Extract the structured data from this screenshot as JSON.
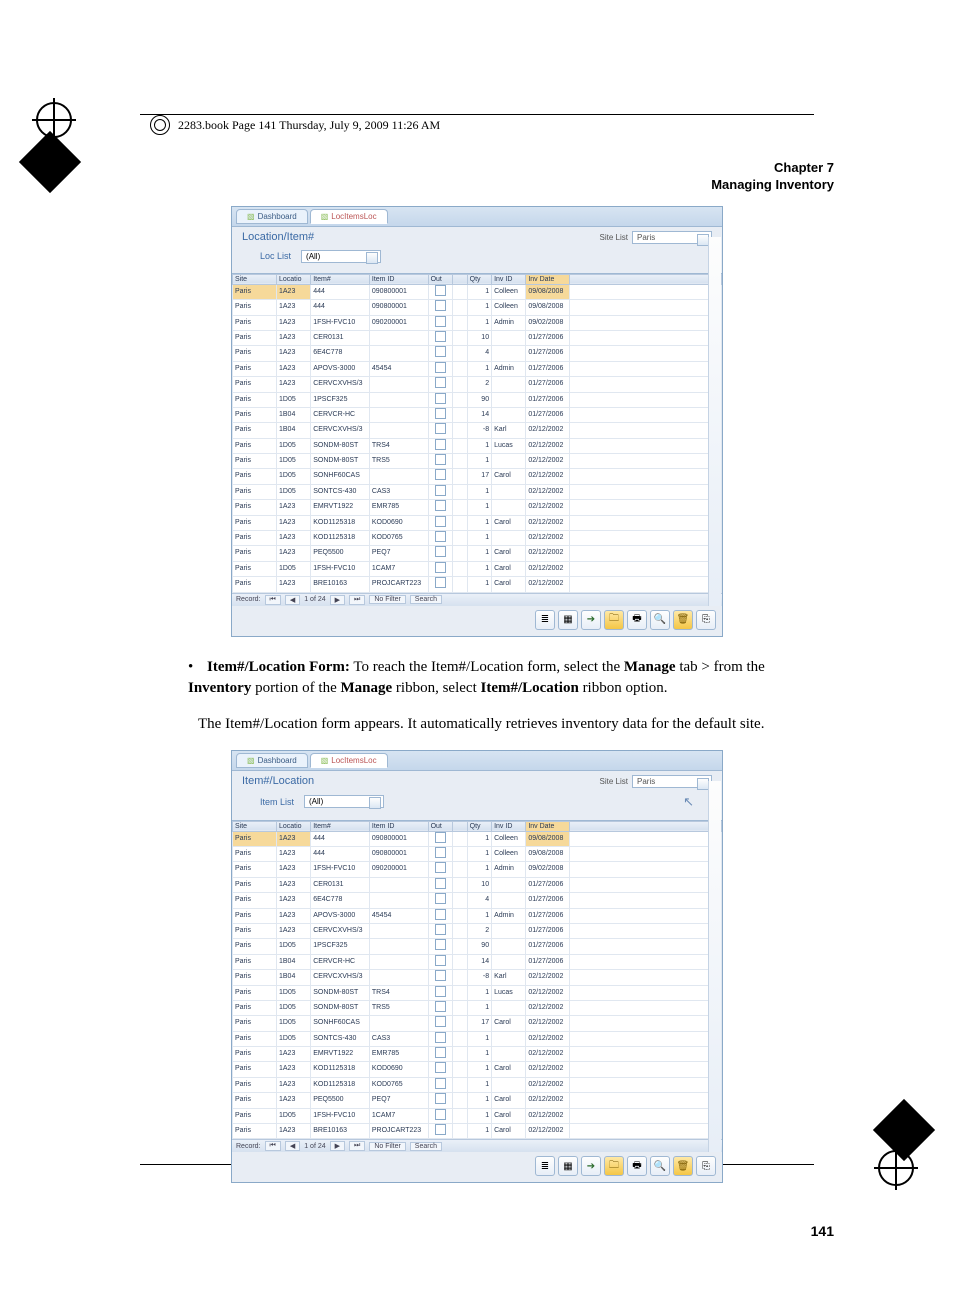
{
  "crop_note": "2283.book  Page 141  Thursday, July 9, 2009  11:26 AM",
  "chapter_line1": "Chapter 7",
  "chapter_line2": "Managing Inventory",
  "page_number": "141",
  "tabs": {
    "dashboard": "Dashboard",
    "loc": "LocItemsLoc"
  },
  "shot1": {
    "title": "Location/Item#",
    "site_label": "Site List",
    "site_value": "Paris",
    "list_label": "Loc List",
    "search_value": "(All)"
  },
  "shot2": {
    "title": "Item#/Location",
    "site_label": "Site List",
    "site_value": "Paris",
    "list_label": "Item List",
    "search_value": "(All)"
  },
  "grid_headers": {
    "site": "Site",
    "loc": "Locatio",
    "item": "Item#",
    "itemid": "Item ID",
    "out": "Out",
    "sort": "",
    "qty": "Qty",
    "inv": "Inv ID",
    "date": "Inv Date"
  },
  "rows": [
    {
      "site": "Paris",
      "loc": "1A23",
      "item": "444",
      "itemid": "090800001",
      "out": false,
      "qty": "1",
      "inv": "Colleen",
      "date": "09/08/2008",
      "sel": true
    },
    {
      "site": "Paris",
      "loc": "1A23",
      "item": "444",
      "itemid": "090800001",
      "out": false,
      "qty": "1",
      "inv": "Colleen",
      "date": "09/08/2008"
    },
    {
      "site": "Paris",
      "loc": "1A23",
      "item": "1FSH-FVC10",
      "itemid": "090200001",
      "out": false,
      "qty": "1",
      "inv": "Admin",
      "date": "09/02/2008"
    },
    {
      "site": "Paris",
      "loc": "1A23",
      "item": "CER0131",
      "itemid": "",
      "out": false,
      "qty": "10",
      "inv": "",
      "date": "01/27/2006"
    },
    {
      "site": "Paris",
      "loc": "1A23",
      "item": "6E4C778",
      "itemid": "",
      "out": false,
      "qty": "4",
      "inv": "",
      "date": "01/27/2006"
    },
    {
      "site": "Paris",
      "loc": "1A23",
      "item": "APOVS-3000",
      "itemid": "45454",
      "out": false,
      "qty": "1",
      "inv": "Admin",
      "date": "01/27/2006"
    },
    {
      "site": "Paris",
      "loc": "1A23",
      "item": "CERVCXVHS/3",
      "itemid": "",
      "out": false,
      "qty": "2",
      "inv": "",
      "date": "01/27/2006"
    },
    {
      "site": "Paris",
      "loc": "1D05",
      "item": "1PSCF325",
      "itemid": "",
      "out": false,
      "qty": "90",
      "inv": "",
      "date": "01/27/2006"
    },
    {
      "site": "Paris",
      "loc": "1B04",
      "item": "CERVCR-HC",
      "itemid": "",
      "out": false,
      "qty": "14",
      "inv": "",
      "date": "01/27/2006"
    },
    {
      "site": "Paris",
      "loc": "1B04",
      "item": "CERVCXVHS/3",
      "itemid": "",
      "out": false,
      "qty": "-8",
      "inv": "Karl",
      "date": "02/12/2002"
    },
    {
      "site": "Paris",
      "loc": "1D05",
      "item": "SONDM-80ST",
      "itemid": "TRS4",
      "out": false,
      "qty": "1",
      "inv": "Lucas",
      "date": "02/12/2002"
    },
    {
      "site": "Paris",
      "loc": "1D05",
      "item": "SONDM-80ST",
      "itemid": "TRS5",
      "out": false,
      "qty": "1",
      "inv": "",
      "date": "02/12/2002"
    },
    {
      "site": "Paris",
      "loc": "1D05",
      "item": "SONHF60CAS",
      "itemid": "",
      "out": false,
      "qty": "17",
      "inv": "Carol",
      "date": "02/12/2002"
    },
    {
      "site": "Paris",
      "loc": "1D05",
      "item": "SONTCS-430",
      "itemid": "CAS3",
      "out": false,
      "qty": "1",
      "inv": "",
      "date": "02/12/2002"
    },
    {
      "site": "Paris",
      "loc": "1A23",
      "item": "EMRVT1922",
      "itemid": "EMR785",
      "out": false,
      "qty": "1",
      "inv": "",
      "date": "02/12/2002"
    },
    {
      "site": "Paris",
      "loc": "1A23",
      "item": "KOD1125318",
      "itemid": "KOD0690",
      "out": false,
      "qty": "1",
      "inv": "Carol",
      "date": "02/12/2002"
    },
    {
      "site": "Paris",
      "loc": "1A23",
      "item": "KOD1125318",
      "itemid": "KOD0765",
      "out": false,
      "qty": "1",
      "inv": "",
      "date": "02/12/2002"
    },
    {
      "site": "Paris",
      "loc": "1A23",
      "item": "PEQ5500",
      "itemid": "PEQ7",
      "out": false,
      "qty": "1",
      "inv": "Carol",
      "date": "02/12/2002"
    },
    {
      "site": "Paris",
      "loc": "1D05",
      "item": "1FSH-FVC10",
      "itemid": "1CAM7",
      "out": false,
      "qty": "1",
      "inv": "Carol",
      "date": "02/12/2002"
    },
    {
      "site": "Paris",
      "loc": "1A23",
      "item": "BRE10163",
      "itemid": "PROJCART223",
      "out": false,
      "qty": "1",
      "inv": "Carol",
      "date": "02/12/2002"
    }
  ],
  "rec_bar": {
    "label": "Record:",
    "first": "⏮",
    "prev": "◀",
    "pos": "1 of 24",
    "next": "▶",
    "last": "⏭",
    "filter": "No Filter",
    "search": "Search"
  },
  "toolbar_icons": [
    "nav-first",
    "grid-view",
    "arrow-right",
    "folder-open",
    "print",
    "preview",
    "delete",
    "exit"
  ],
  "body": {
    "bullet_lead": "Item#/Location Form:",
    "bullet_rest": " To reach the Item#/Location form, select the ",
    "b_manage": "Manage",
    "t_tab": " tab > from the ",
    "b_inventory": "Inventory",
    "t_portion": " portion of the ",
    "b_manage2": "Manage",
    "t_ribbon": " ribbon, select ",
    "b_itemloc": "Item#/Location",
    "t_ribbon_opt": " ribbon option.",
    "para2": "The Item#/Location form appears. It automatically retrieves inventory data for the default site."
  }
}
